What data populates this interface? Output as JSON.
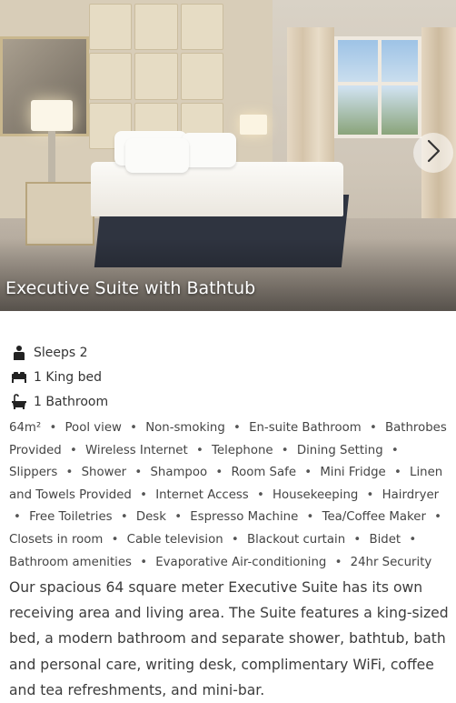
{
  "room": {
    "title": "Executive Suite with Bathtub"
  },
  "carousel": {
    "next_icon": "chevron-right-icon"
  },
  "facts": [
    {
      "icon": "person-icon",
      "label": "Sleeps 2"
    },
    {
      "icon": "bed-icon",
      "label": "1 King bed"
    },
    {
      "icon": "bathtub-icon",
      "label": "1 Bathroom"
    }
  ],
  "amenities": [
    "64m²",
    "Pool view",
    "Non-smoking",
    "En-suite Bathroom",
    "Bathrobes Provided",
    "Wireless Internet",
    "Telephone",
    "Dining Setting",
    "Slippers",
    "Shower",
    "Shampoo",
    "Room Safe",
    "Mini Fridge",
    "Linen and Towels Provided",
    "Internet Access",
    "Housekeeping",
    "Hairdryer",
    "Free Toiletries",
    "Desk",
    "Espresso Machine",
    "Tea/Coffee Maker",
    "Closets in room",
    "Cable television",
    "Blackout curtain",
    "Bidet",
    "Bathroom amenities",
    "Evaporative Air-conditioning",
    "24hr Security"
  ],
  "description": "Our spacious 64 square meter Executive Suite has its own receiving area and living area. The Suite features a king-sized bed, a modern bathroom and separate shower, bathtub, bath and personal care, writing desk, complimentary WiFi, coffee and tea refreshments, and mini-bar."
}
